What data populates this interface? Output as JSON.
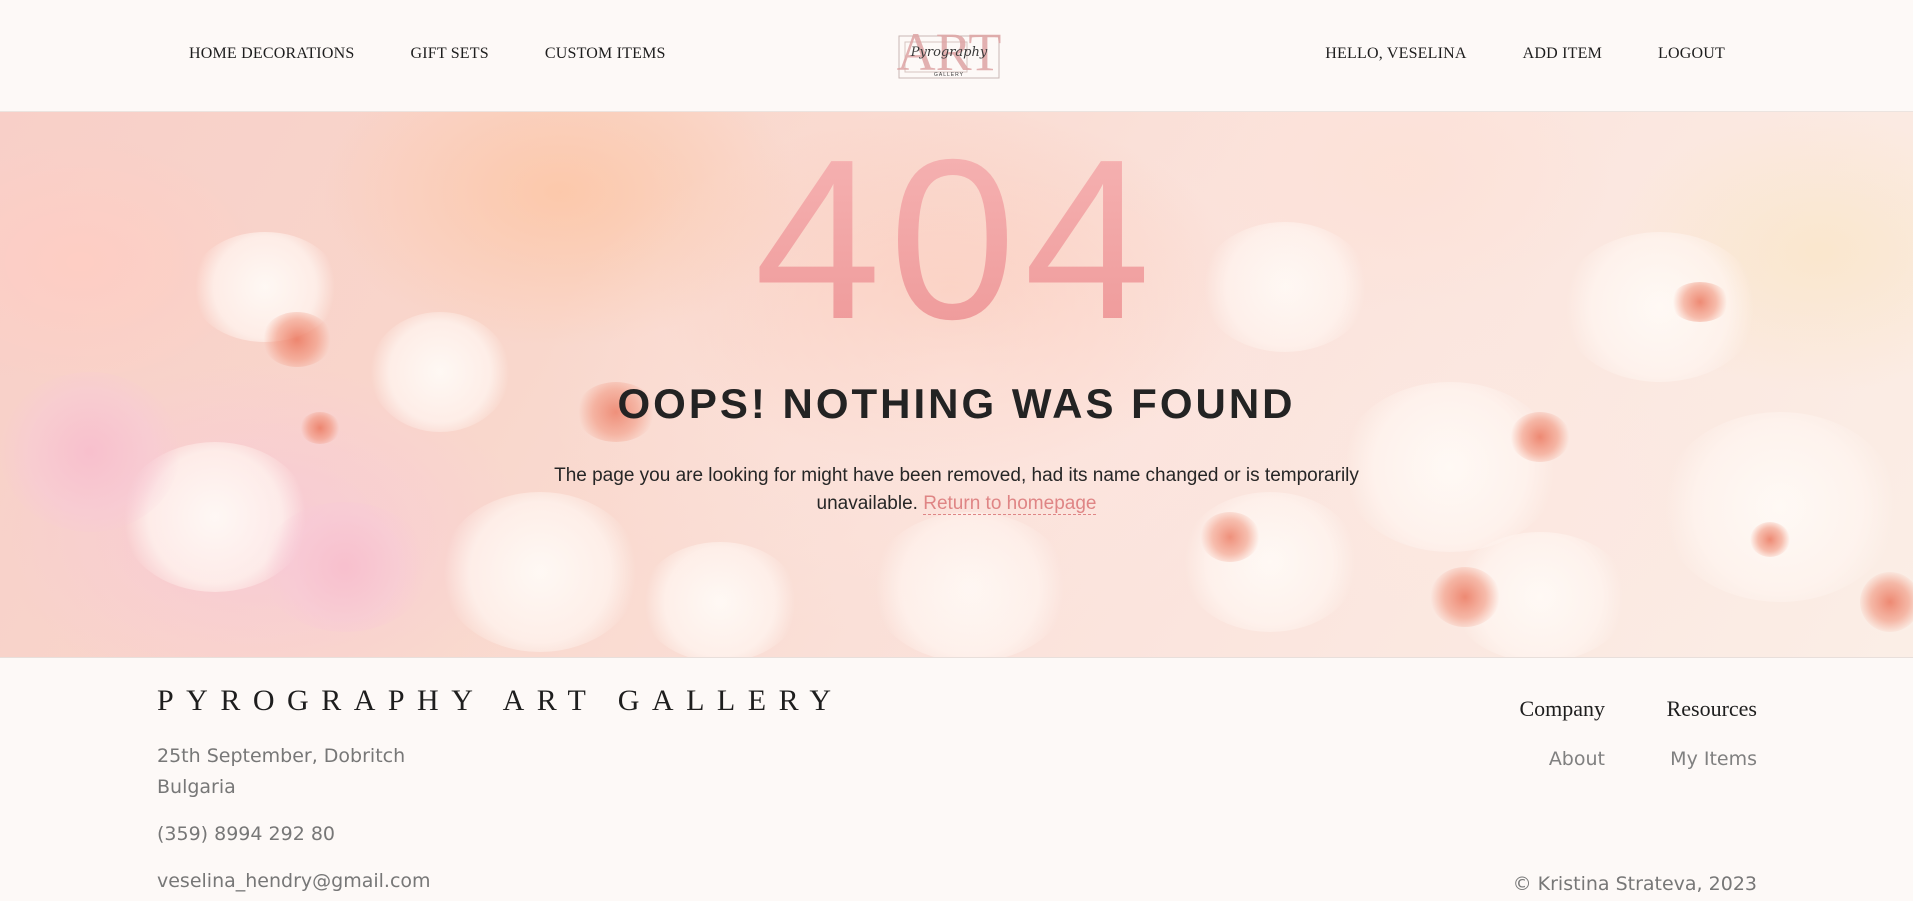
{
  "header": {
    "nav_left": [
      {
        "label": "HOME DECORATIONS"
      },
      {
        "label": "GIFT SETS"
      },
      {
        "label": "CUSTOM ITEMS"
      }
    ],
    "nav_right": [
      {
        "label": "HELLO, VESELINA"
      },
      {
        "label": "ADD ITEM"
      },
      {
        "label": "LOGOUT"
      }
    ],
    "logo": {
      "big_text": "ART",
      "script_text": "Pyrography",
      "small_text": "GALLERY"
    }
  },
  "hero": {
    "code": "404",
    "title": "OOPS! NOTHING WAS FOUND",
    "message": "The page you are looking for might have been removed, had its name changed or is temporarily unavailable.",
    "link_label": "Return to homepage"
  },
  "footer": {
    "brand": "PYROGRAPHY ART GALLERY",
    "address_line1": "25th September, Dobritch",
    "address_line2": "Bulgaria",
    "phone": "(359) 8994 292 80",
    "email": "veselina_hendry@gmail.com",
    "columns": [
      {
        "title": "Company",
        "link": "About"
      },
      {
        "title": "Resources",
        "link": "My Items"
      }
    ],
    "copyright": "© Kristina Strateva, 2023"
  },
  "colors": {
    "accent": "#df8585",
    "page_background": "#fdf9f7",
    "text_dark": "#232323",
    "text_muted": "#777777"
  }
}
